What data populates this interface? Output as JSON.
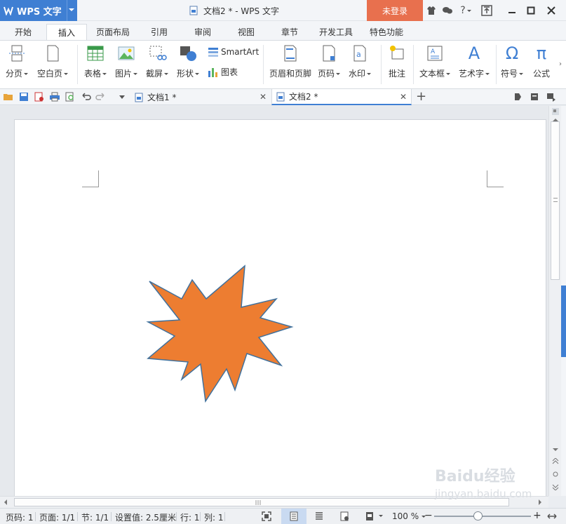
{
  "titlebar": {
    "app_name": "WPS 文字",
    "doc_title": "文档2 * - WPS 文字",
    "login": "未登录",
    "help": "?",
    "colors": {
      "app_menu": "#3f7fd3",
      "login": "#e8704e"
    }
  },
  "ribbon_tabs": [
    "开始",
    "插入",
    "页面布局",
    "引用",
    "审阅",
    "视图",
    "章节",
    "开发工具",
    "特色功能"
  ],
  "ribbon": {
    "page_break": "分页",
    "blank_page": "空白页",
    "table": "表格",
    "picture": "图片",
    "screenshot": "截屏",
    "shapes": "形状",
    "smartart": "SmartArt",
    "chart": "图表",
    "header_footer": "页眉和页脚",
    "page_number": "页码",
    "watermark": "水印",
    "comment": "批注",
    "textbox": "文本框",
    "wordart": "艺术字",
    "symbol": "符号",
    "formula": "公式",
    "symbol_glyph": "Ω",
    "formula_glyph": "π",
    "wordart_glyph": "A"
  },
  "doc_tabs": [
    {
      "label": "文档1 *"
    },
    {
      "label": "文档2 *"
    }
  ],
  "document": {
    "shape": {
      "type": "12-point star",
      "fill": "#ed7d31",
      "stroke": "#41719c"
    }
  },
  "statusbar": {
    "page_no": "页码: 1",
    "page": "页面: 1/1",
    "section": "节: 1/1",
    "setting": "设置值: 2.5厘米",
    "line": "行: 1",
    "column": "列: 1",
    "zoom": "100 %",
    "zoom_level": 0.45
  },
  "watermark": {
    "text": "Baidu经验",
    "url": "jingyan.baidu.com"
  }
}
